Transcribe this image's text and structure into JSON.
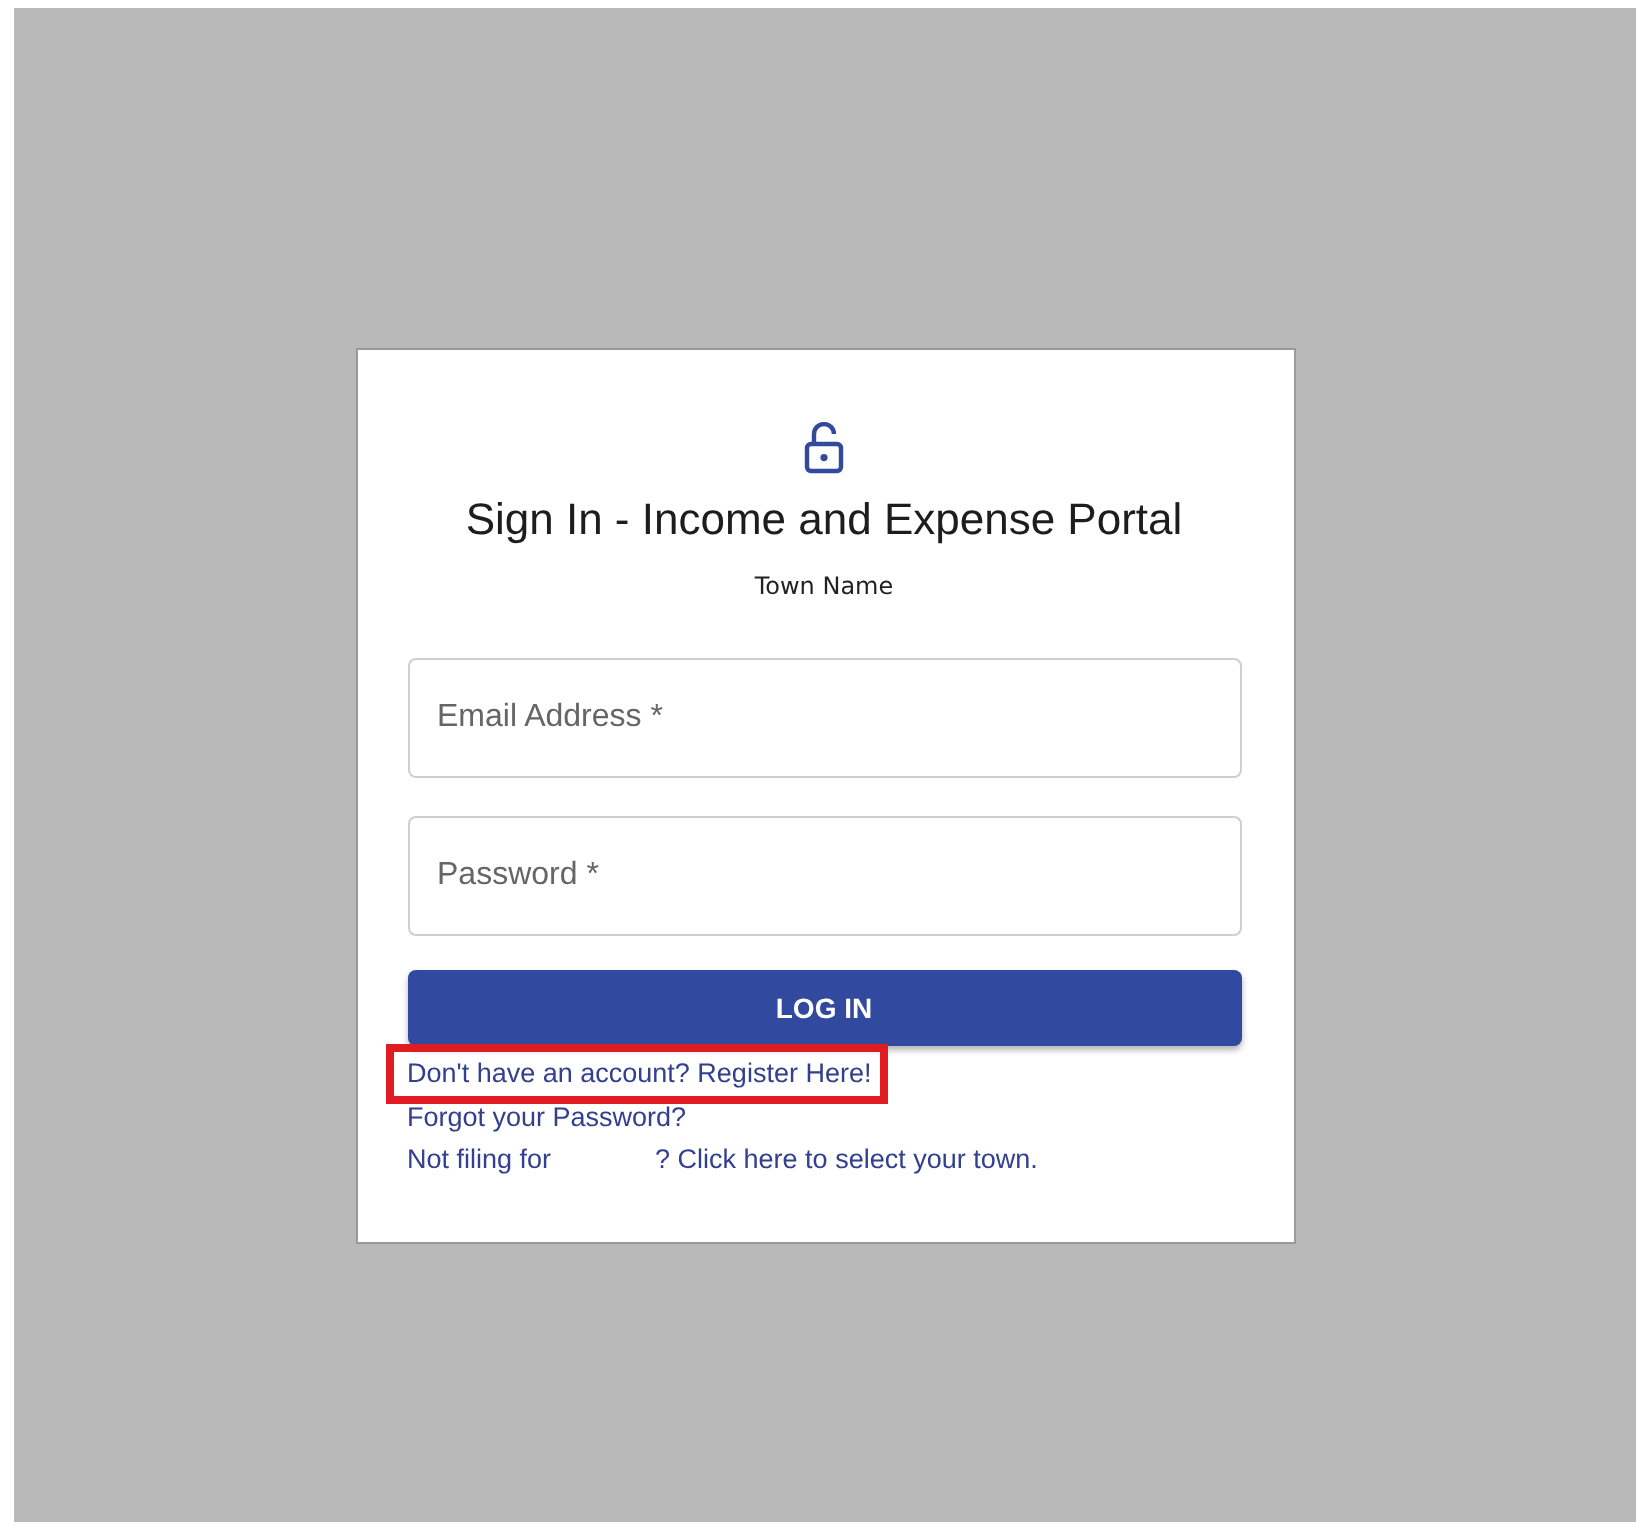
{
  "card": {
    "title": "Sign In - Income and Expense Portal",
    "subtitle": "Town Name",
    "fields": [
      {
        "label": "Email Address",
        "required_mark": "*"
      },
      {
        "label": "Password",
        "required_mark": "*"
      }
    ],
    "login_button": "LOG IN",
    "links": [
      {
        "text": "Don't have an account? Register Here!",
        "highlighted": true
      },
      {
        "text": "Forgot your Password?",
        "highlighted": false
      }
    ],
    "town_link": {
      "prefix": "Not filing for",
      "suffix": "? Click here to select your town."
    }
  }
}
